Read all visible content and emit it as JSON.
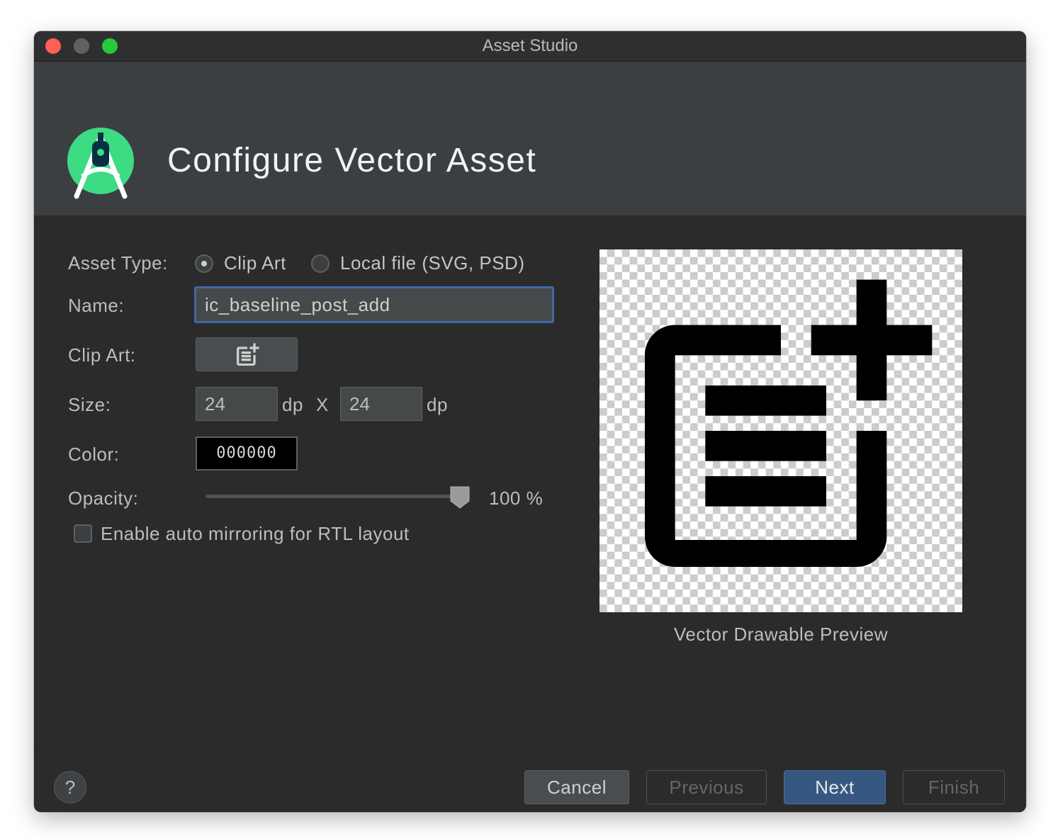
{
  "window": {
    "title": "Asset Studio"
  },
  "header": {
    "title": "Configure Vector Asset",
    "logo_icon": "android-studio-logo-icon"
  },
  "form": {
    "asset_type_label": "Asset Type:",
    "asset_type_options": [
      "Clip Art",
      "Local file (SVG, PSD)"
    ],
    "asset_type_selected": "Clip Art",
    "name_label": "Name:",
    "name_value": "ic_baseline_post_add",
    "clipart_label": "Clip Art:",
    "clipart_icon": "post-add-icon",
    "size_label": "Size:",
    "size_width": "24",
    "size_height": "24",
    "size_unit": "dp",
    "size_separator": "X",
    "color_label": "Color:",
    "color_value": "000000",
    "opacity_label": "Opacity:",
    "opacity_value": "100 %",
    "opacity_level": 1.0,
    "auto_mirror_label": "Enable auto mirroring for RTL layout",
    "auto_mirror_checked": false
  },
  "preview": {
    "caption": "Vector Drawable Preview",
    "icon": "post-add-icon"
  },
  "footer": {
    "help_label": "?",
    "cancel_label": "Cancel",
    "previous_label": "Previous",
    "next_label": "Next",
    "finish_label": "Finish"
  },
  "colors": {
    "accent_focus": "#3f68a8",
    "primary_button": "#365880",
    "dialog_bg": "#2b2b2b",
    "header_bg": "#3c3f41",
    "logo_green": "#3ddc84"
  }
}
